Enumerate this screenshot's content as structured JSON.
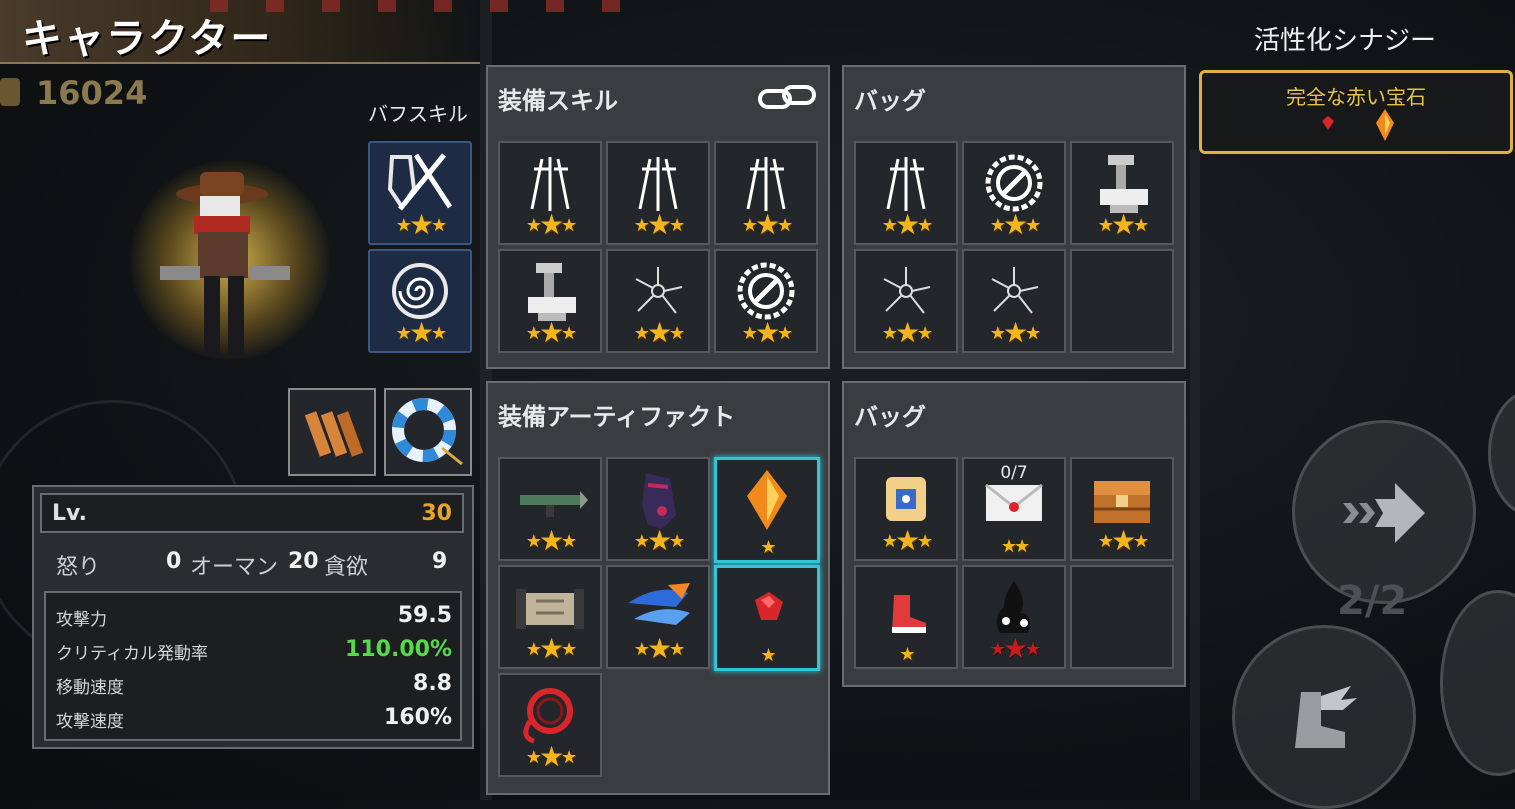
{
  "header": {
    "title": "キャラクター",
    "coins": "16024"
  },
  "buff": {
    "title": "バフスキル",
    "slots": [
      {
        "icon": "crossed-swords-shield-icon",
        "stars": 3
      },
      {
        "icon": "spiral-shield-icon",
        "stars": 3
      }
    ]
  },
  "character": {
    "portrait": "cowboy-gunslinger-icon"
  },
  "equip_small": [
    {
      "icon": "bullets-icon"
    },
    {
      "icon": "lifebuoy-icon"
    }
  ],
  "stats": {
    "lv_label": "Lv.",
    "lv_value": "30",
    "traits": [
      {
        "label": "怒り",
        "value": "0"
      },
      {
        "label": "オーマン",
        "value": "20"
      },
      {
        "label": "貪欲",
        "value": "9"
      }
    ],
    "lines": [
      {
        "label": "攻撃力",
        "value": "59.5"
      },
      {
        "label": "クリティカル発動率",
        "value": "110.00%"
      },
      {
        "label": "移動速度",
        "value": "8.8"
      },
      {
        "label": "攻撃速度",
        "value": "160%"
      }
    ]
  },
  "skills_panel": {
    "title": "装備スキル",
    "link_icon": "link-icon",
    "slots": [
      {
        "icon": "triple-daggers-icon",
        "stars": 3
      },
      {
        "icon": "triple-daggers-icon",
        "stars": 3
      },
      {
        "icon": "triple-daggers-icon",
        "stars": 3
      },
      {
        "icon": "anvil-hammer-icon",
        "stars": 3
      },
      {
        "icon": "shatter-icon",
        "stars": 3
      },
      {
        "icon": "saw-ring-icon",
        "stars": 3
      }
    ]
  },
  "skills_bag": {
    "title": "バッグ",
    "slots": [
      {
        "icon": "triple-daggers-icon",
        "stars": 3
      },
      {
        "icon": "saw-ring-icon",
        "stars": 3
      },
      {
        "icon": "anvil-hammer-icon",
        "stars": 3
      },
      {
        "icon": "shatter-icon",
        "stars": 3
      },
      {
        "icon": "shatter-icon",
        "stars": 3
      },
      {
        "icon": "",
        "stars": 0
      }
    ]
  },
  "artifacts_panel": {
    "title": "装備アーティファクト",
    "slots": [
      {
        "icon": "rocket-launcher-icon",
        "stars": 3
      },
      {
        "icon": "dark-gauntlet-icon",
        "stars": 3
      },
      {
        "icon": "orange-crystal-icon",
        "stars": 1,
        "highlight": true
      },
      {
        "icon": "scroll-icon",
        "stars": 3
      },
      {
        "icon": "feather-wings-icon",
        "stars": 3
      },
      {
        "icon": "red-gem-icon",
        "stars": 1,
        "highlight": true
      },
      {
        "icon": "red-lasso-icon",
        "stars": 3
      }
    ]
  },
  "artifacts_bag": {
    "title": "バッグ",
    "slots": [
      {
        "icon": "dice-icon",
        "stars": 3,
        "count": ""
      },
      {
        "icon": "letter-icon",
        "stars": 2,
        "count": "0/7"
      },
      {
        "icon": "treasure-chest-icon",
        "stars": 3,
        "count": ""
      },
      {
        "icon": "red-boot-icon",
        "stars": 1,
        "count": ""
      },
      {
        "icon": "black-fire-icon",
        "stars": 3,
        "red": true,
        "count": ""
      },
      {
        "icon": "",
        "stars": 0,
        "count": ""
      }
    ]
  },
  "synergy": {
    "title": "活性化シナジー",
    "active": "完全な赤い宝石",
    "icons": [
      "red-gem-icon",
      "orange-crystal-icon"
    ]
  },
  "controls": {
    "page": "2/2",
    "dash_icon": "arrow-right-icon",
    "boot_icon": "winged-boot-icon"
  },
  "colors": {
    "star": "#f2b51d",
    "highlight": "#2ec6d8",
    "gold": "#e8a52c",
    "green": "#57d94c"
  }
}
